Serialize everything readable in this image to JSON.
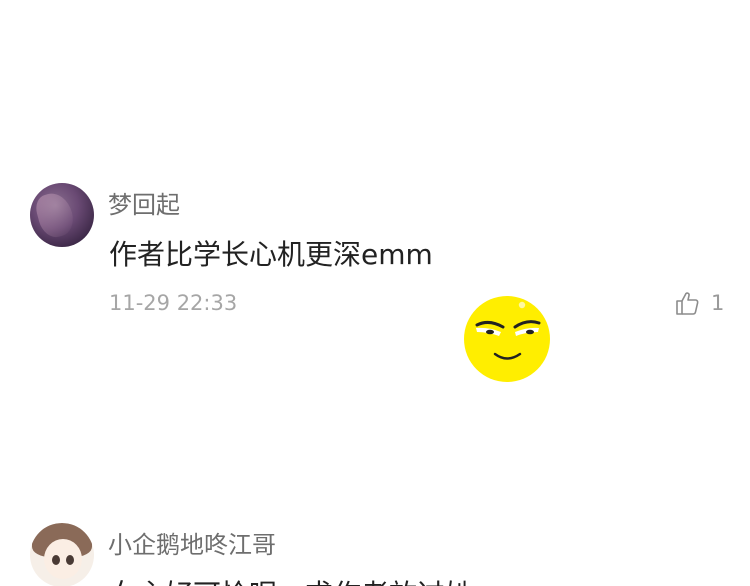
{
  "comments": [
    {
      "username": "梦回起",
      "text": "作者比学长心机更深emm",
      "timestamp": "11-29 22:33",
      "likes": "1"
    },
    {
      "username": "小企鹅地咚江哥",
      "text": "女主好可怜呢，求作者放过她"
    }
  ],
  "icons": {
    "like": "thumbs-up-icon",
    "sticker": "smug-emoji-sticker"
  },
  "colors": {
    "username": "#6e6e6e",
    "text": "#222222",
    "timestamp": "#a6a6a6",
    "sticker_yellow": "#ffee00"
  }
}
